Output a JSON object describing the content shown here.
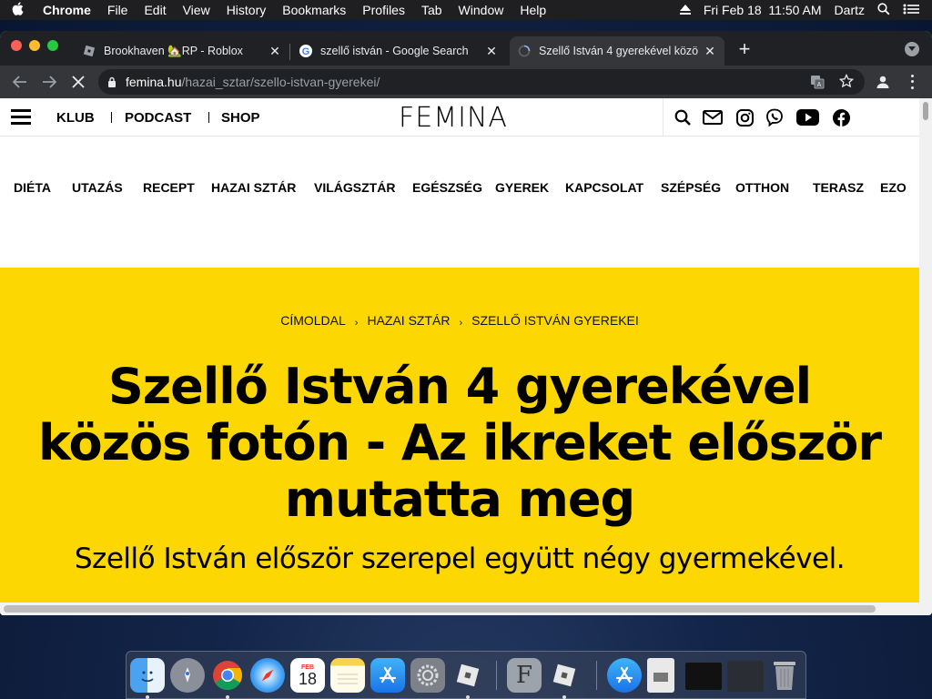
{
  "menubar": {
    "app": "Chrome",
    "items": [
      "File",
      "Edit",
      "View",
      "History",
      "Bookmarks",
      "Profiles",
      "Tab",
      "Window",
      "Help"
    ],
    "datetime": "Fri Feb 18  11:50 AM",
    "user": "Dartz"
  },
  "tabs": [
    {
      "title": "Brookhaven 🏡RP - Roblox",
      "icon": "roblox-icon"
    },
    {
      "title": "szellő istván - Google Search",
      "icon": "google-icon"
    },
    {
      "title": "Szellő István 4 gyerekével közö",
      "icon": "loading-icon"
    }
  ],
  "toolbar": {
    "url_host": "femina.hu",
    "url_path": "/hazai_sztar/szello-istvan-gyerekei/"
  },
  "site": {
    "logo": "FEMINA",
    "top_nav": [
      "KLUB",
      "PODCAST",
      "SHOP"
    ],
    "categories": [
      "DIÉTA",
      "UTAZÁS",
      "RECEPT",
      "HAZAI SZTÁR",
      "VILÁGSZTÁR",
      "EGÉSZSÉG",
      "GYEREK",
      "KAPCSOLAT",
      "SZÉPSÉG",
      "OTTHON",
      "TERASZ",
      "EZO"
    ],
    "header_icons": [
      "search-icon",
      "mail-icon",
      "instagram-icon",
      "viber-icon",
      "youtube-icon",
      "facebook-icon"
    ]
  },
  "article": {
    "breadcrumb": [
      "CÍMOLDAL",
      "HAZAI SZTÁR",
      "SZELLŐ ISTVÁN GYEREKEI"
    ],
    "headline": "Szellő István 4 gyerekével közös fotón - Az ikreket először mutatta meg",
    "lead": "Szellő István először szerepel együtt négy gyermekével.",
    "hero_color": "#fdd701"
  },
  "dock": {
    "calendar_month": "FEB",
    "calendar_day": "18"
  }
}
